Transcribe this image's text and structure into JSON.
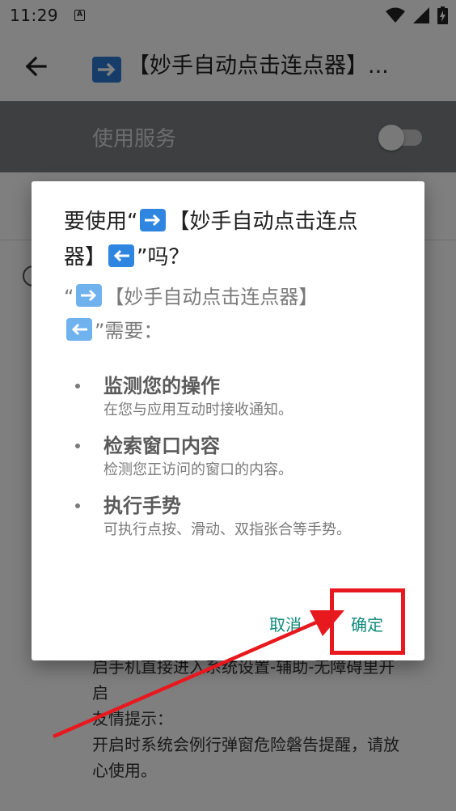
{
  "status_bar": {
    "time": "11:29",
    "notification_letter": "A",
    "icons": [
      "wifi-icon",
      "signal-icon",
      "battery-icon"
    ]
  },
  "app_bar": {
    "title": "【妙手自动点击连点器】..."
  },
  "service": {
    "label": "使用服务",
    "enabled": false
  },
  "background_text": {
    "line1": "启手机直接进入系统设置-辅助-无障碍里开",
    "line2": "启",
    "line3": " 友情提示：",
    "line4": " 开启时系统会例行弹窗危险磐告提醒，请放",
    "line5": "心使用。"
  },
  "dialog": {
    "title_part1": "要使用“",
    "title_part2": "【妙手自动点击连点",
    "title_part3": "器】",
    "title_part4": "”吗？",
    "sub_part1": "“",
    "sub_part2": "【妙手自动点击连点器】",
    "sub_part3": "”需要：",
    "permissions": [
      {
        "title": "监测您的操作",
        "desc": "在您与应用互动时接收通知。"
      },
      {
        "title": "检索窗口内容",
        "desc": "检测您正访问的窗口的内容。"
      },
      {
        "title": "执行手势",
        "desc": "可执行点按、滑动、双指张合等手势。"
      }
    ],
    "cancel_label": "取消",
    "ok_label": "确定"
  },
  "colors": {
    "accent": "#0d8a7a",
    "highlight": "#e8191e",
    "emoji_blue": "#2f86e0"
  }
}
